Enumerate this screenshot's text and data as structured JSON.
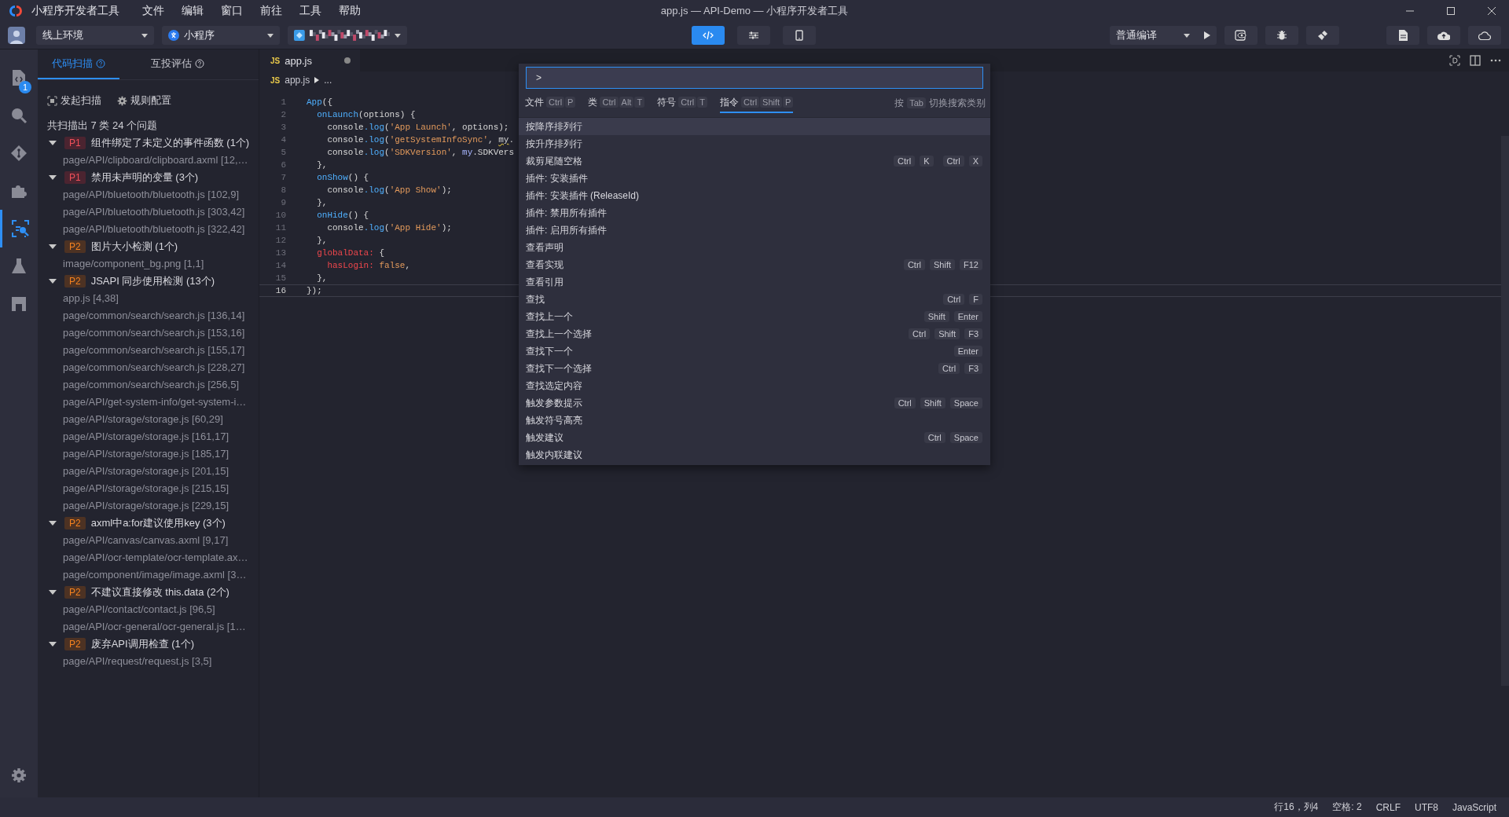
{
  "window": {
    "app_name": "小程序开发者工具",
    "title": "app.js — API-Demo — 小程序开发者工具"
  },
  "menu": [
    "文件",
    "编辑",
    "窗口",
    "前往",
    "工具",
    "帮助"
  ],
  "toolbar": {
    "environment": "线上环境",
    "app_type": "小程序",
    "compile_mode": "普通编译",
    "views": [
      {
        "kind": "code",
        "selected": true
      },
      {
        "kind": "tune",
        "selected": false
      },
      {
        "kind": "phone",
        "selected": false
      }
    ]
  },
  "activity_bar": {
    "badge": "1",
    "items": [
      {
        "kind": "file",
        "selected": false
      },
      {
        "kind": "search",
        "selected": false
      },
      {
        "kind": "git",
        "selected": false
      },
      {
        "kind": "puzzle",
        "selected": false
      },
      {
        "kind": "scan",
        "selected": true
      },
      {
        "kind": "flask",
        "selected": false
      },
      {
        "kind": "box",
        "selected": false
      }
    ]
  },
  "sidebar": {
    "tabs": [
      {
        "label": "代码扫描",
        "selected": true
      },
      {
        "label": "互投评估",
        "selected": false
      }
    ],
    "actions": [
      "发起扫描",
      "规则配置"
    ],
    "summary": "共扫描出 7 类 24 个问题",
    "groups": [
      {
        "priority": "P1",
        "title": "组件绑定了未定义的事件函数 (1个)",
        "expanded": true,
        "children": [
          "page/API/clipboard/clipboard.axml [12,…"
        ]
      },
      {
        "priority": "P1",
        "title": "禁用未声明的变量 (3个)",
        "expanded": true,
        "children": [
          "page/API/bluetooth/bluetooth.js [102,9]",
          "page/API/bluetooth/bluetooth.js [303,42]",
          "page/API/bluetooth/bluetooth.js [322,42]"
        ]
      },
      {
        "priority": "P2",
        "title": "图片大小检测 (1个)",
        "expanded": true,
        "children": [
          "image/component_bg.png [1,1]"
        ]
      },
      {
        "priority": "P2",
        "title": "JSAPI 同步使用检测 (13个)",
        "expanded": true,
        "children": [
          "app.js [4,38]",
          "page/common/search/search.js [136,14]",
          "page/common/search/search.js [153,16]",
          "page/common/search/search.js [155,17]",
          "page/common/search/search.js [228,27]",
          "page/common/search/search.js [256,5]",
          "page/API/get-system-info/get-system-i…",
          "page/API/storage/storage.js [60,29]",
          "page/API/storage/storage.js [161,17]",
          "page/API/storage/storage.js [185,17]",
          "page/API/storage/storage.js [201,15]",
          "page/API/storage/storage.js [215,15]",
          "page/API/storage/storage.js [229,15]"
        ]
      },
      {
        "priority": "P2",
        "title": "axml中a:for建议使用key (3个)",
        "expanded": true,
        "children": [
          "page/API/canvas/canvas.axml [9,17]",
          "page/API/ocr-template/ocr-template.ax…",
          "page/component/image/image.axml [3…"
        ]
      },
      {
        "priority": "P2",
        "title": "不建议直接修改 this.data (2个)",
        "expanded": true,
        "children": [
          "page/API/contact/contact.js [96,5]",
          "page/API/ocr-general/ocr-general.js [1…"
        ]
      },
      {
        "priority": "P2",
        "title": "废弃API调用检查 (1个)",
        "expanded": true,
        "children": [
          "page/API/request/request.js [3,5]"
        ]
      }
    ]
  },
  "editor": {
    "tab": {
      "icon": "JS",
      "name": "app.js",
      "modified": true
    },
    "breadcrumb": {
      "icon": "JS",
      "file": "app.js",
      "rest": "..."
    },
    "lines": [
      {
        "number": "1",
        "current": false,
        "tokens": [
          {
            "text": "App",
            "kind": "fn"
          },
          {
            "text": "({",
            "kind": "plain"
          }
        ]
      },
      {
        "number": "2",
        "current": false,
        "tokens": [
          {
            "text": "  onLaunch",
            "kind": "fn"
          },
          {
            "text": "(options) {",
            "kind": "plain"
          }
        ]
      },
      {
        "number": "3",
        "current": false,
        "tokens": [
          {
            "text": "    console",
            "kind": "plain"
          },
          {
            "text": ".log",
            "kind": "fn"
          },
          {
            "text": "(",
            "kind": "plain"
          },
          {
            "text": "'App Launch'",
            "kind": "str"
          },
          {
            "text": ", options);",
            "kind": "plain"
          }
        ]
      },
      {
        "number": "4",
        "current": false,
        "tokens": [
          {
            "text": "    console",
            "kind": "plain"
          },
          {
            "text": ".log",
            "kind": "fn"
          },
          {
            "text": "(",
            "kind": "plain"
          },
          {
            "text": "'getSystemInfoSync'",
            "kind": "str"
          },
          {
            "text": ", ",
            "kind": "plain"
          },
          {
            "text": "my",
            "kind": "warn"
          },
          {
            "text": ".",
            "kind": "plain"
          }
        ]
      },
      {
        "number": "5",
        "current": false,
        "tokens": [
          {
            "text": "    console",
            "kind": "plain"
          },
          {
            "text": ".log",
            "kind": "fn"
          },
          {
            "text": "(",
            "kind": "plain"
          },
          {
            "text": "'SDKVersion'",
            "kind": "str"
          },
          {
            "text": ", ",
            "kind": "plain"
          },
          {
            "text": "my",
            "kind": "obj"
          },
          {
            "text": ".SDKVers",
            "kind": "plain"
          }
        ]
      },
      {
        "number": "6",
        "current": false,
        "tokens": [
          {
            "text": "  },",
            "kind": "plain"
          }
        ]
      },
      {
        "number": "7",
        "current": false,
        "tokens": [
          {
            "text": "  onShow",
            "kind": "fn"
          },
          {
            "text": "() {",
            "kind": "plain"
          }
        ]
      },
      {
        "number": "8",
        "current": false,
        "tokens": [
          {
            "text": "    console",
            "kind": "plain"
          },
          {
            "text": ".log",
            "kind": "fn"
          },
          {
            "text": "(",
            "kind": "plain"
          },
          {
            "text": "'App Show'",
            "kind": "str"
          },
          {
            "text": ");",
            "kind": "plain"
          }
        ]
      },
      {
        "number": "9",
        "current": false,
        "tokens": [
          {
            "text": "  },",
            "kind": "plain"
          }
        ]
      },
      {
        "number": "10",
        "current": false,
        "tokens": [
          {
            "text": "  onHide",
            "kind": "fn"
          },
          {
            "text": "() {",
            "kind": "plain"
          }
        ]
      },
      {
        "number": "11",
        "current": false,
        "tokens": [
          {
            "text": "    console",
            "kind": "plain"
          },
          {
            "text": ".log",
            "kind": "fn"
          },
          {
            "text": "(",
            "kind": "plain"
          },
          {
            "text": "'App Hide'",
            "kind": "str"
          },
          {
            "text": ");",
            "kind": "plain"
          }
        ]
      },
      {
        "number": "12",
        "current": false,
        "tokens": [
          {
            "text": "  },",
            "kind": "plain"
          }
        ]
      },
      {
        "number": "13",
        "current": false,
        "tokens": [
          {
            "text": "  globalData:",
            "kind": "key"
          },
          {
            "text": " {",
            "kind": "plain"
          }
        ]
      },
      {
        "number": "14",
        "current": false,
        "tokens": [
          {
            "text": "    hasLogin:",
            "kind": "key"
          },
          {
            "text": " false",
            "kind": "str"
          },
          {
            "text": ",",
            "kind": "plain"
          }
        ]
      },
      {
        "number": "15",
        "current": false,
        "tokens": [
          {
            "text": "  },",
            "kind": "plain"
          }
        ]
      },
      {
        "number": "16",
        "current": true,
        "tokens": [
          {
            "text": "});",
            "kind": "plain"
          }
        ]
      }
    ]
  },
  "command_palette": {
    "input": ">",
    "categories": [
      {
        "label": "文件",
        "keys": [
          "Ctrl",
          "P"
        ],
        "selected": false
      },
      {
        "label": "类",
        "keys": [
          "Ctrl",
          "Alt",
          "T"
        ],
        "selected": false
      },
      {
        "label": "符号",
        "keys": [
          "Ctrl",
          "T"
        ],
        "selected": false
      },
      {
        "label": "指令",
        "keys": [
          "Ctrl",
          "Shift",
          "P"
        ],
        "selected": true
      }
    ],
    "hint": {
      "prefix": "按",
      "key": "Tab",
      "suffix": "切换搜索类别"
    },
    "commands": [
      {
        "label": "按降序排列行",
        "selected": true
      },
      {
        "label": "按升序排列行",
        "selected": false
      },
      {
        "label": "裁剪尾随空格",
        "selected": false,
        "keys": [
          [
            "Ctrl",
            "K"
          ],
          [
            "Ctrl",
            "X"
          ]
        ]
      },
      {
        "label": "插件: 安装插件",
        "selected": false
      },
      {
        "label": "插件: 安装插件 (ReleaseId)",
        "selected": false
      },
      {
        "label": "插件: 禁用所有插件",
        "selected": false
      },
      {
        "label": "插件: 启用所有插件",
        "selected": false
      },
      {
        "label": "查看声明",
        "selected": false
      },
      {
        "label": "查看实现",
        "selected": false,
        "keys": [
          [
            "Ctrl",
            "Shift",
            "F12"
          ]
        ]
      },
      {
        "label": "查看引用",
        "selected": false
      },
      {
        "label": "查找",
        "selected": false,
        "keys": [
          [
            "Ctrl",
            "F"
          ]
        ]
      },
      {
        "label": "查找上一个",
        "selected": false,
        "keys": [
          [
            "Shift",
            "Enter"
          ]
        ]
      },
      {
        "label": "查找上一个选择",
        "selected": false,
        "keys": [
          [
            "Ctrl",
            "Shift",
            "F3"
          ]
        ]
      },
      {
        "label": "查找下一个",
        "selected": false,
        "keys": [
          [
            "Enter"
          ]
        ]
      },
      {
        "label": "查找下一个选择",
        "selected": false,
        "keys": [
          [
            "Ctrl",
            "F3"
          ]
        ]
      },
      {
        "label": "查找选定内容",
        "selected": false
      },
      {
        "label": "触发参数提示",
        "selected": false,
        "keys": [
          [
            "Ctrl",
            "Shift",
            "Space"
          ]
        ]
      },
      {
        "label": "触发符号高亮",
        "selected": false
      },
      {
        "label": "触发建议",
        "selected": false,
        "keys": [
          [
            "Ctrl",
            "Space"
          ]
        ]
      },
      {
        "label": "触发内联建议",
        "selected": false
      }
    ]
  },
  "status_bar": [
    "行16，列4",
    "空格: 2",
    "CRLF",
    "UTF8",
    "JavaScript"
  ]
}
